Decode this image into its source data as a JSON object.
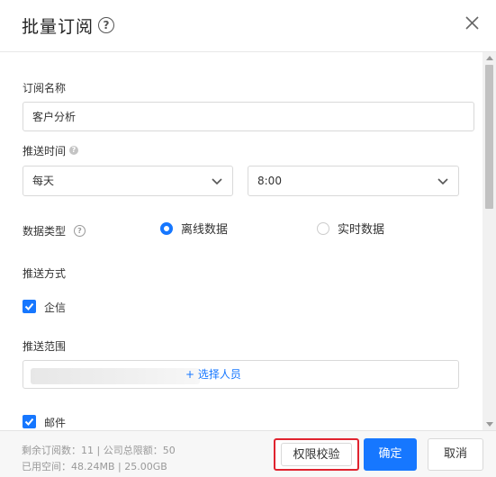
{
  "dialog": {
    "title": "批量订阅",
    "help_glyph": "?",
    "close_glyph": "×"
  },
  "form": {
    "name_label": "订阅名称",
    "name_value": "客户分析",
    "push_time_label": "推送时间",
    "frequency_value": "每天",
    "time_value": "8:00",
    "data_type_label": "数据类型",
    "data_type_options": [
      {
        "label": "离线数据",
        "selected": true
      },
      {
        "label": "实时数据",
        "selected": false
      }
    ],
    "push_method_label": "推送方式",
    "method_qixin_label": "企信",
    "method_qixin_checked": true,
    "push_scope_label": "推送范围",
    "select_people_label": "+ 选择人员",
    "method_email_label": "邮件",
    "method_email_checked": true
  },
  "footer": {
    "quota_line1": "剩余订阅数：11 | 公司总限额：50",
    "quota_line2": "已用空间：48.24MB | 25.00GB",
    "permission_check_label": "权限校验",
    "confirm_label": "确定",
    "cancel_label": "取消"
  },
  "colors": {
    "accent": "#1677ff",
    "highlight_border": "#e0232f"
  }
}
